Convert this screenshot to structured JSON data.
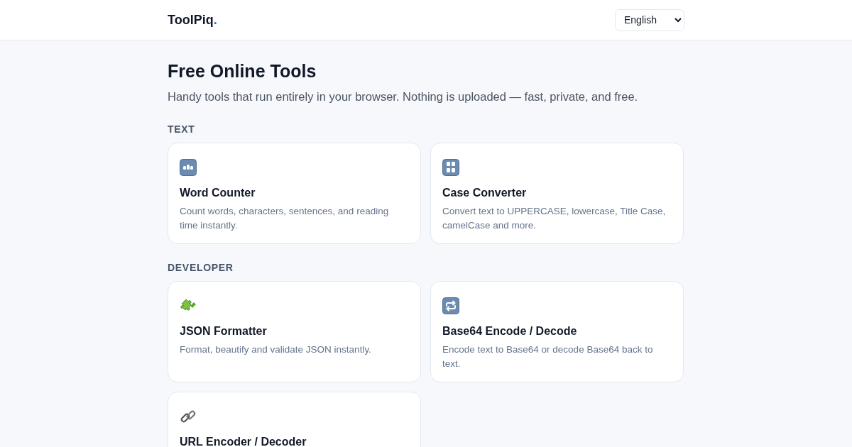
{
  "header": {
    "logo": {
      "name": "ToolPiq",
      "dot": "."
    },
    "language": "English"
  },
  "hero": {
    "title": "Free Online Tools",
    "subtitle": "Handy tools that run entirely in your browser. Nothing is uploaded — fast, private, and free."
  },
  "sections": [
    {
      "label": "TEXT",
      "tools": [
        {
          "kind": "lower",
          "title": "Word Counter",
          "description": "Count words, characters, sentences, and reading time instantly."
        },
        {
          "kind": "upper",
          "title": "Case Converter",
          "description": "Convert text to UPPERCASE, lowercase, Title Case, camelCase and more."
        }
      ]
    },
    {
      "label": "DEVELOPER",
      "tools": [
        {
          "kind": "puzzle",
          "title": "JSON Formatter",
          "description": "Format, beautify and validate JSON instantly."
        },
        {
          "kind": "repeat",
          "title": "Base64 Encode / Decode",
          "description": "Encode text to Base64 or decode Base64 back to text."
        },
        {
          "kind": "link",
          "title": "URL Encoder / Decoder"
        }
      ]
    }
  ]
}
